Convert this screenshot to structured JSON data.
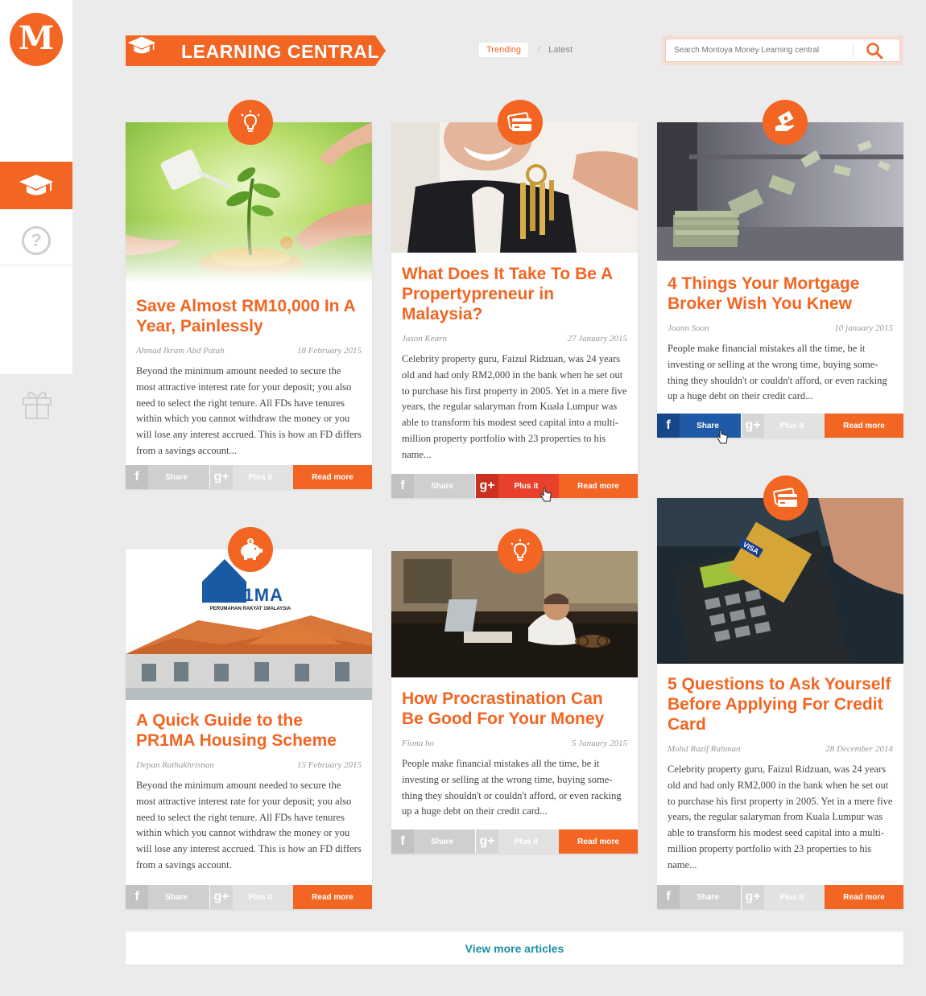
{
  "brand": {
    "logo_letter": "M",
    "accent": "#f26522",
    "link_color": "#1a8fa4"
  },
  "sidebar": {
    "items": [
      {
        "name": "learning",
        "icon": "graduation-cap-icon",
        "active": true
      },
      {
        "name": "help",
        "icon": "question-icon",
        "label": "?"
      },
      {
        "name": "rewards",
        "icon": "gift-icon"
      }
    ]
  },
  "header": {
    "title": "LEARNING CENTRAL",
    "tabs": {
      "trending": "Trending",
      "separator": "/",
      "latest": "Latest"
    },
    "search": {
      "placeholder": "Search Montoya Money Learning central"
    }
  },
  "cards": [
    {
      "badge": "lightbulb-icon",
      "title": "Save Almost RM10,000 In A Year, Painlessly",
      "author": "Ahmad Ikram Abd Patah",
      "date": "18 February 2015",
      "excerpt": "Beyond the minimum amount needed to secure the most attractive interest rate for your deposit; you also need to select the right tenure. All FDs have tenures within which you cannot withdraw the money or you will lose any interest accrued. This is how an FD differs from a savings account...",
      "share": "Share",
      "plus": "Plus it",
      "read": "Read more"
    },
    {
      "badge": "credit-card-icon",
      "title": "What Does It Take To Be A Propertypreneur in Malaysia?",
      "author": "Jason Kearn",
      "date": "27 January 2015",
      "excerpt": "Celebrity property guru, Faizul Ridzuan, was 24 years old and had only RM2,000 in the bank when he set out to purchase his first property in 2005. Yet in a mere five years, the regular salaryman from Kuala Lumpur was able to transform his modest seed capital into a multi-million property portfolio with 23 properties to his name...",
      "share": "Share",
      "plus": "Plus it",
      "read": "Read more"
    },
    {
      "badge": "money-hand-icon",
      "title": "4 Things Your Mortgage Broker Wish You Knew",
      "author": "Joann Soon",
      "date": "10 january 2015",
      "excerpt": "People make financial mistakes all the time, be it investing or selling at the wrong time, buying some-thing they shouldn't or couldn't afford, or even racking up a huge debt on their credit card...",
      "share": "Share",
      "plus": "Plus it",
      "read": "Read more"
    },
    {
      "badge": "piggy-bank-icon",
      "title": "A Quick Guide to the PR1MA Housing Scheme",
      "author": "Depan Rathakhrisnan",
      "date": "15 February 2015",
      "excerpt": "Beyond the minimum amount needed to secure the most attractive interest rate for your deposit; you also need to select the right tenure. All FDs have tenures within which you cannot withdraw the money or you will lose any interest accrued. This is how an FD differs from a savings account.",
      "image_logo": "PR1MA",
      "image_logo_sub": "PERUMAHAN RAKYAT 1MALAYSIA",
      "share": "Share",
      "plus": "Plus it",
      "read": "Read more"
    },
    {
      "badge": "lightbulb-icon",
      "title": "How Procrastination Can Be Good For Your Money",
      "author": "Fiona ho",
      "date": "5 January 2015",
      "excerpt": "People make financial mistakes all the time, be it investing or selling at the wrong time, buying some-thing they shouldn't or couldn't afford, or even racking up a huge debt on their credit card...",
      "share": "Share",
      "plus": "Plus it",
      "read": "Read more"
    },
    {
      "badge": "credit-card-icon",
      "title": "5 Questions to Ask Yourself Before Applying For Credit Card",
      "author": "Mohd Razif Rahman",
      "date": "28 December 2014",
      "excerpt": "Celebrity property guru, Faizul Ridzuan, was 24 years old and had only RM2,000 in the bank when he set out to purchase his first property in 2005. Yet in a mere five years, the regular salaryman from Kuala Lumpur was able to transform his modest seed capital into a multi-million property portfolio with 23 properties to his name...",
      "image_card_brand": "VISA",
      "share": "Share",
      "plus": "Plus it",
      "read": "Read more"
    }
  ],
  "footer": {
    "view_more": "View more articles"
  }
}
